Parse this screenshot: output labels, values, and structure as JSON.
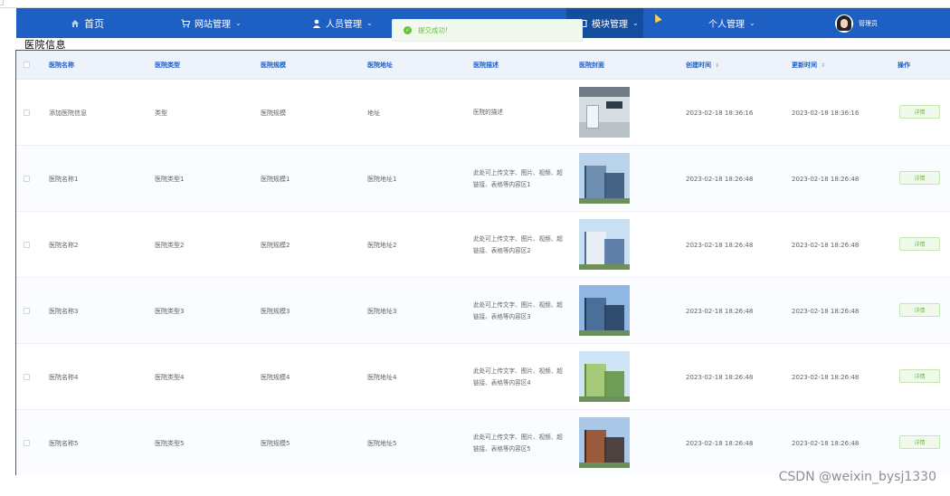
{
  "nav": {
    "items": [
      {
        "label": "首页",
        "icon": "home-icon",
        "dropdown": false
      },
      {
        "label": "网站管理",
        "icon": "cart-icon",
        "dropdown": true
      },
      {
        "label": "人员管理",
        "icon": "user-icon",
        "dropdown": true
      },
      {
        "label": "模块管理",
        "icon": "module-icon",
        "dropdown": true,
        "active": true
      },
      {
        "label": "个人管理",
        "icon": "",
        "dropdown": true
      }
    ],
    "user": "管理员"
  },
  "toast": {
    "text": "提交成功!"
  },
  "section_title": "医院信息",
  "table": {
    "headers": [
      "医院名称",
      "医院类型",
      "医院规模",
      "医院地址",
      "医院描述",
      "医院封面",
      "创建时间",
      "更新时间",
      "操作"
    ],
    "detail_label": "详情",
    "rows": [
      {
        "name": "添加医院信息",
        "type": "类型",
        "scale": "医院规模",
        "address": "地址",
        "desc": "医院的描述",
        "created": "2023-02-18 18:36:16",
        "updated": "2023-02-18 18:36:16"
      },
      {
        "name": "医院名称1",
        "type": "医院类型1",
        "scale": "医院规模1",
        "address": "医院地址1",
        "desc": "此处可上传文字、图片、视频、超链接、表格等内容区1",
        "created": "2023-02-18 18:26:48",
        "updated": "2023-02-18 18:26:48"
      },
      {
        "name": "医院名称2",
        "type": "医院类型2",
        "scale": "医院规模2",
        "address": "医院地址2",
        "desc": "此处可上传文字、图片、视频、超链接、表格等内容区2",
        "created": "2023-02-18 18:26:48",
        "updated": "2023-02-18 18:26:48"
      },
      {
        "name": "医院名称3",
        "type": "医院类型3",
        "scale": "医院规模3",
        "address": "医院地址3",
        "desc": "此处可上传文字、图片、视频、超链接、表格等内容区3",
        "created": "2023-02-18 18:26:48",
        "updated": "2023-02-18 18:26:48"
      },
      {
        "name": "医院名称4",
        "type": "医院类型4",
        "scale": "医院规模4",
        "address": "医院地址4",
        "desc": "此处可上传文字、图片、视频、超链接、表格等内容区4",
        "created": "2023-02-18 18:26:48",
        "updated": "2023-02-18 18:26:48"
      },
      {
        "name": "医院名称5",
        "type": "医院类型5",
        "scale": "医院规模5",
        "address": "医院地址5",
        "desc": "此处可上传文字、图片、视频、超链接、表格等内容区5",
        "created": "2023-02-18 18:26:48",
        "updated": "2023-02-18 18:26:48"
      }
    ]
  },
  "watermark": "CSDN @weixin_bysj1330",
  "colors": {
    "nav_bg": "#1e5fc4",
    "nav_active": "#154d9e",
    "success": "#67c23a",
    "header_text": "#1e5fc4"
  }
}
